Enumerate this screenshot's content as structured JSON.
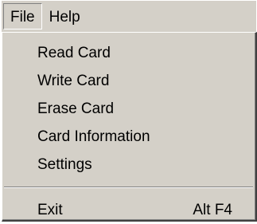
{
  "menubar": {
    "items": [
      {
        "label": "File",
        "active": true
      },
      {
        "label": "Help",
        "active": false
      }
    ]
  },
  "file_menu": {
    "items": [
      {
        "label": "Read Card",
        "shortcut": ""
      },
      {
        "label": "Write Card",
        "shortcut": ""
      },
      {
        "label": "Erase Card",
        "shortcut": ""
      },
      {
        "label": "Card Information",
        "shortcut": ""
      },
      {
        "label": "Settings",
        "shortcut": ""
      }
    ],
    "exit": {
      "label": "Exit",
      "shortcut": "Alt F4"
    }
  },
  "colors": {
    "face": "#d4d0c8",
    "shadow": "#808080",
    "highlight": "#ffffff",
    "text": "#000000"
  }
}
